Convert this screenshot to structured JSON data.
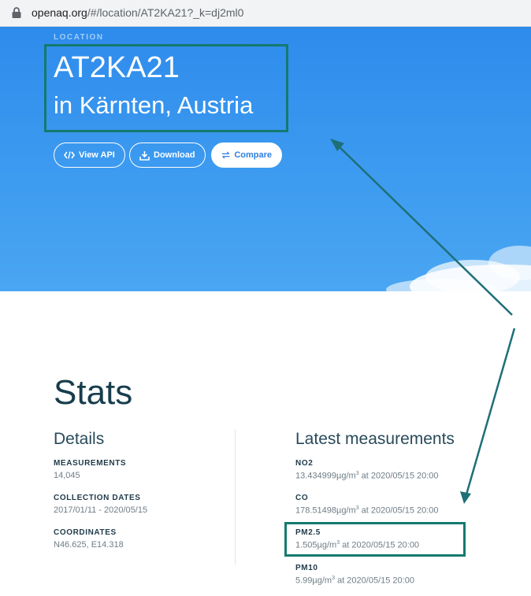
{
  "browser": {
    "url_host": "openaq.org",
    "url_path": "/#/location/AT2KA21?_k=dj2ml0"
  },
  "hero": {
    "eyebrow": "LOCATION",
    "title": "AT2KA21",
    "subtitle": "in Kärnten, Austria",
    "buttons": {
      "view_api": "View API",
      "download": "Download",
      "compare": "Compare"
    }
  },
  "stats": {
    "title": "Stats",
    "details": {
      "heading": "Details",
      "items": [
        {
          "label": "MEASUREMENTS",
          "value": "14,045"
        },
        {
          "label": "COLLECTION DATES",
          "value": "2017/01/11 - 2020/05/15"
        },
        {
          "label": "COORDINATES",
          "value": "N46.625, E14.318"
        }
      ]
    },
    "latest": {
      "heading": "Latest measurements",
      "unit": "µg/m",
      "unit_sup": "3",
      "items": [
        {
          "label": "NO2",
          "amount": "13.434999",
          "time": " at 2020/05/15 20:00"
        },
        {
          "label": "CO",
          "amount": "178.51498",
          "time": " at 2020/05/15 20:00"
        },
        {
          "label": "PM2.5",
          "amount": "1.505",
          "time": " at 2020/05/15 20:00"
        },
        {
          "label": "PM10",
          "amount": "5.99",
          "time": " at 2020/05/15 20:00"
        }
      ]
    }
  },
  "colors": {
    "hero_blue": "#3e9cf0",
    "annotation_teal": "#147a6e",
    "heading_dark": "#173d4d"
  }
}
